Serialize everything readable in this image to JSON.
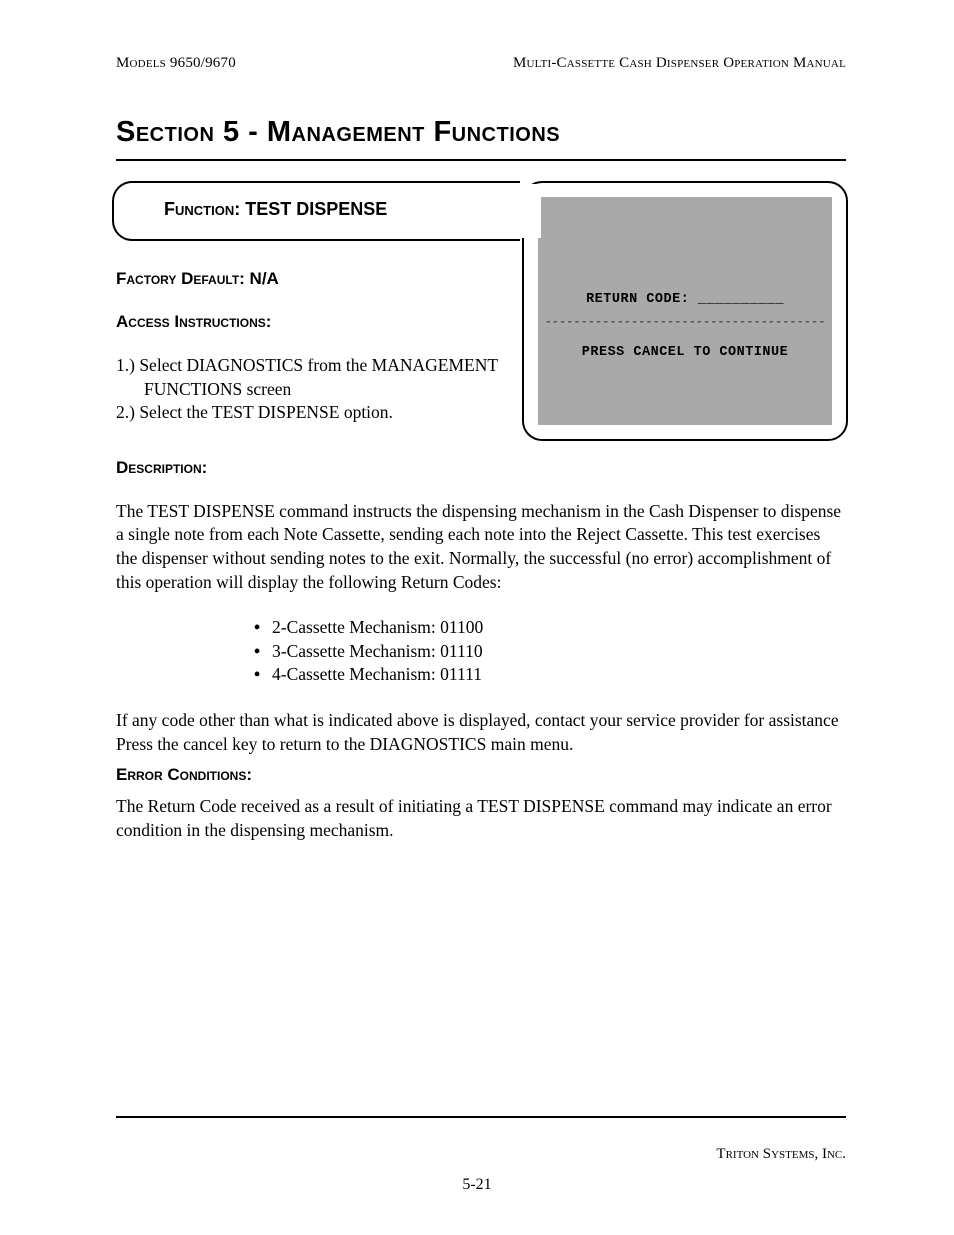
{
  "header": {
    "left": "Models 9650/9670",
    "right": "Multi-Cassette Cash Dispenser Operation Manual"
  },
  "section_title": "Section 5 - Management Functions",
  "function_box": {
    "label_prefix": "Function: ",
    "label_value": "TEST DISPENSE"
  },
  "screen": {
    "return_code_label": "RETURN CODE:",
    "return_code_value": "__________",
    "divider": "---------------------------------------",
    "press_line": "PRESS CANCEL TO CONTINUE"
  },
  "left": {
    "factory_default_label": "Factory Default: ",
    "factory_default_value": "N/A",
    "access_label": "Access Instructions:",
    "steps": [
      "1.)  Select DIAGNOSTICS from the MANAGEMENT FUNCTIONS screen",
      "2.)  Select the TEST DISPENSE  option."
    ]
  },
  "description": {
    "label": "Description:",
    "para1": "The TEST DISPENSE command instructs the dispensing mechanism in the Cash Dispenser to dispense a single note from each Note Cassette, sending each note into the Reject Cassette.  This test exercises the dispenser without sending notes to the exit.  Normally, the successful (no error) accomplishment of this operation will display the following Return Codes:",
    "codes": [
      "2-Cassette Mechanism: 01100",
      "3-Cassette Mechanism: 01110",
      "4-Cassette Mechanism: 01111"
    ],
    "para2": "If any code other than what is indicated above is displayed, contact your service provider for assistance  Press the cancel key to return to the DIAGNOSTICS main menu."
  },
  "error": {
    "label": "Error Conditions:",
    "para": "The Return Code received as a result of initiating a TEST DISPENSE command may indicate an error  condition in the dispensing mechanism."
  },
  "footer": {
    "company": "Triton Systems, Inc.",
    "page": "5-21"
  }
}
